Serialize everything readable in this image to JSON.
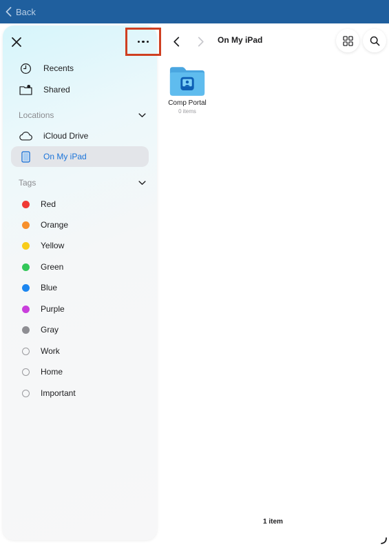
{
  "topbar": {
    "back_label": "Back"
  },
  "sidebar": {
    "favorites": [
      {
        "label": "Recents",
        "icon": "clock-icon"
      },
      {
        "label": "Shared",
        "icon": "shared-folder-icon"
      }
    ],
    "locations": {
      "header": "Locations",
      "items": [
        {
          "label": "iCloud Drive",
          "icon": "cloud-icon"
        },
        {
          "label": "On My iPad",
          "icon": "ipad-icon",
          "selected": true
        }
      ]
    },
    "tags": {
      "header": "Tags",
      "items": [
        {
          "label": "Red",
          "color": "#f03a35"
        },
        {
          "label": "Orange",
          "color": "#f7902c"
        },
        {
          "label": "Yellow",
          "color": "#f8cc1b"
        },
        {
          "label": "Green",
          "color": "#33c759"
        },
        {
          "label": "Blue",
          "color": "#1c86f0"
        },
        {
          "label": "Purple",
          "color": "#c93fdc"
        },
        {
          "label": "Gray",
          "color": "#8e8e93"
        },
        {
          "label": "Work",
          "color": ""
        },
        {
          "label": "Home",
          "color": ""
        },
        {
          "label": "Important",
          "color": ""
        }
      ]
    }
  },
  "content": {
    "title": "On My iPad",
    "folder": {
      "name": "Comp Portal",
      "subtitle": "0 items"
    },
    "item_count": "1 item"
  },
  "colors": {
    "topbar": "#1f5f9e",
    "accent": "#1a73d9",
    "highlight_box": "#cf3f21",
    "folder": "#5bb8ec"
  }
}
